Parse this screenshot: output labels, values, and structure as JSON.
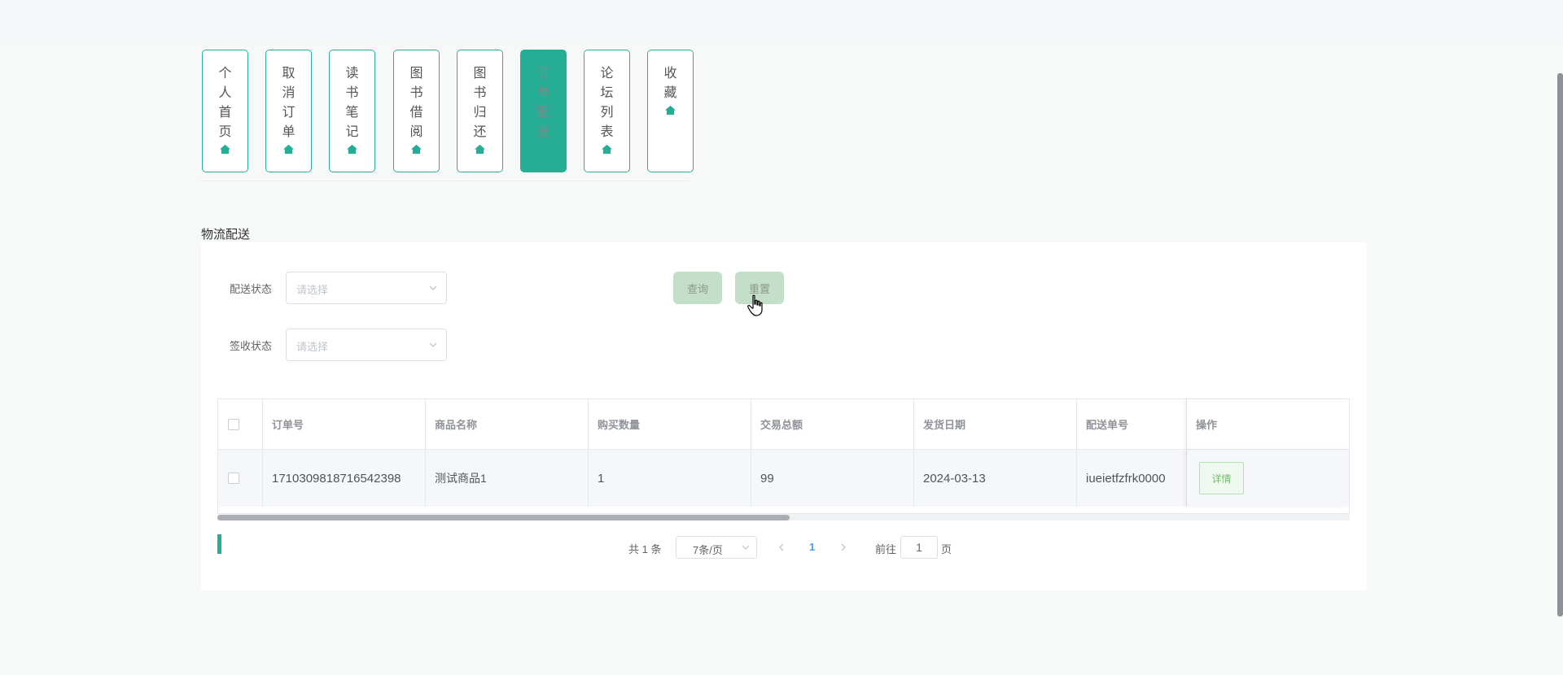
{
  "tabs": [
    {
      "label": "个人首页",
      "icon": "home-icon",
      "active": false
    },
    {
      "label": "取消订单",
      "icon": "home-icon",
      "active": false
    },
    {
      "label": "读书笔记",
      "icon": "home-icon",
      "active": false
    },
    {
      "label": "图书借阅",
      "icon": "home-icon",
      "active": false
    },
    {
      "label": "图书归还",
      "icon": "home-icon",
      "active": false
    },
    {
      "label": "订单配送",
      "icon": "home-icon",
      "active": true
    },
    {
      "label": "论坛列表",
      "icon": "home-icon",
      "active": false
    },
    {
      "label": "收藏",
      "icon": "home-icon",
      "active": false
    }
  ],
  "section_title": "物流配送",
  "filters": {
    "delivery_status": {
      "label": "配送状态",
      "placeholder": "请选择"
    },
    "receipt_status": {
      "label": "签收状态",
      "placeholder": "请选择"
    }
  },
  "buttons": {
    "query": "查询",
    "reset": "重置"
  },
  "table": {
    "columns": [
      "订单号",
      "商品名称",
      "购买数量",
      "交易总额",
      "发货日期",
      "配送单号",
      "操作"
    ],
    "rows": [
      {
        "order_no": "1710309818716542398",
        "product": "测试商品1",
        "qty": "1",
        "total": "99",
        "ship_date": "2024-03-13",
        "tracking_no": "iueietfzfrk0000",
        "action": "详情"
      }
    ]
  },
  "pagination": {
    "total_text": "共 1 条",
    "page_size": "7条/页",
    "current_page": "1",
    "goto_label": "前往",
    "goto_value": "1",
    "page_suffix": "页"
  },
  "colors": {
    "accent": "#26ad96",
    "button_bg": "#c4dfc9",
    "page_bg": "#f7f8f8"
  }
}
